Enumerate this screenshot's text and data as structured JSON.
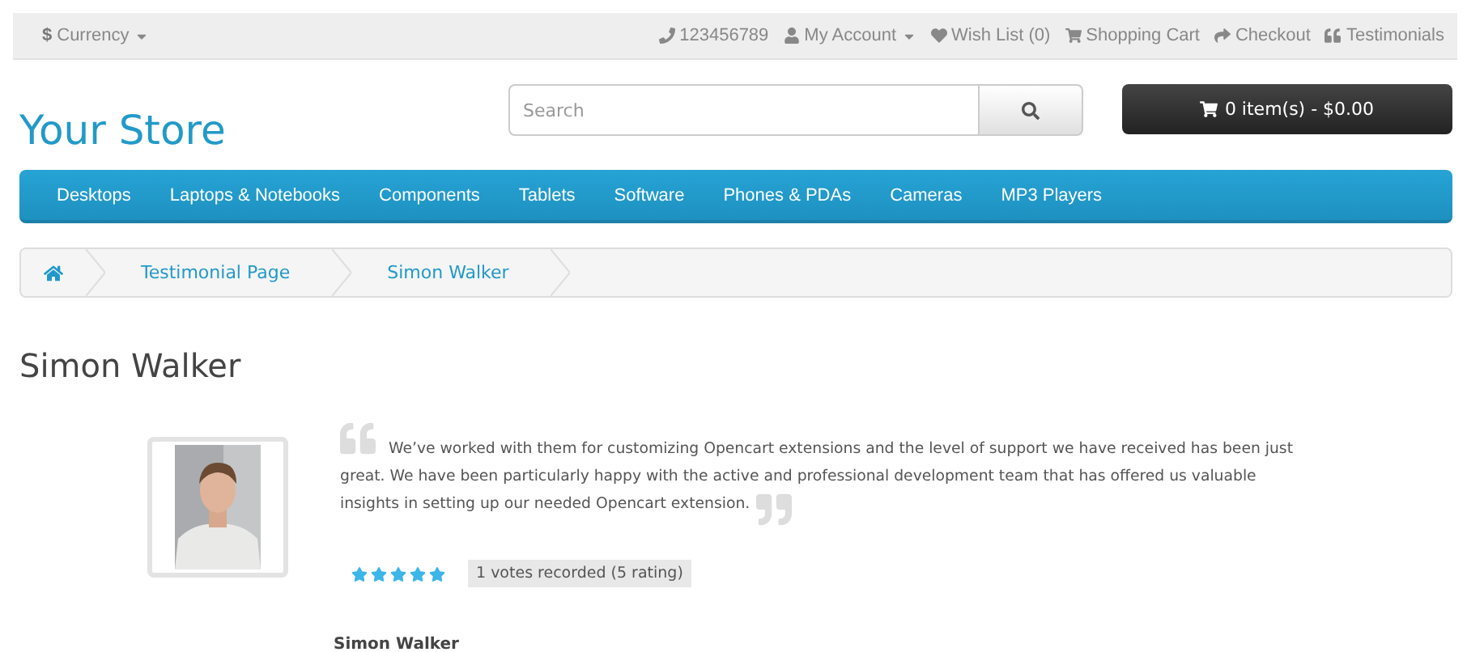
{
  "top_bar": {
    "currency": {
      "symbol": "$",
      "label": "Currency"
    },
    "links": [
      {
        "kind": "phone",
        "label": "123456789"
      },
      {
        "kind": "account",
        "label": "My Account"
      },
      {
        "kind": "wishlist",
        "label": "Wish List (0)"
      },
      {
        "kind": "cart",
        "label": "Shopping Cart"
      },
      {
        "kind": "checkout",
        "label": "Checkout"
      },
      {
        "kind": "testimonials",
        "label": "Testimonials"
      }
    ]
  },
  "header": {
    "logo": "Your Store",
    "search": {
      "placeholder": "Search"
    },
    "cart_button": "0 item(s) - $0.00"
  },
  "menu": [
    "Desktops",
    "Laptops & Notebooks",
    "Components",
    "Tablets",
    "Software",
    "Phones & PDAs",
    "Cameras",
    "MP3 Players"
  ],
  "breadcrumb": [
    "Testimonial Page",
    "Simon Walker"
  ],
  "page_title": "Simon Walker",
  "testimonial": {
    "text": "We’ve worked with them for customizing Opencart extensions and the level of support we have received has been just great. We have been particularly happy with the active and professional development team that has offered us valuable insights in setting up our needed Opencart extension.",
    "stars": 5,
    "votes": "1 votes recorded (5 rating)",
    "author": "Simon Walker"
  }
}
